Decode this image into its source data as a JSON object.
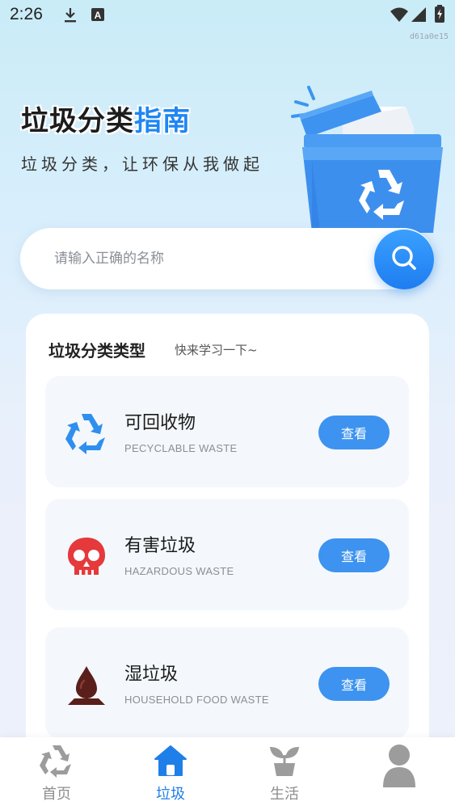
{
  "status_bar": {
    "time": "2:26",
    "build_id": "d61a0e15",
    "icons": [
      "download-icon",
      "notification-a-icon",
      "wifi-icon",
      "signal-icon",
      "battery-charging-icon"
    ]
  },
  "hero": {
    "title_part1": "垃圾分类",
    "title_part2": "指南",
    "subtitle": "垃圾分类，让环保从我做起",
    "illustration": "recycle-bin-icon"
  },
  "search": {
    "placeholder": "请输入正确的名称",
    "value": "",
    "button_icon": "search-icon"
  },
  "types_section": {
    "title": "垃圾分类类型",
    "subtitle": "快来学习一下~",
    "items": [
      {
        "name": "可回收物",
        "en": "PECYCLABLE WASTE",
        "button": "查看",
        "icon": "recycle-icon",
        "color": "#2f8fee"
      },
      {
        "name": "有害垃圾",
        "en": "HAZARDOUS WASTE",
        "button": "查看",
        "icon": "skull-icon",
        "color": "#e5393b"
      },
      {
        "name": "湿垃圾",
        "en": "HOUSEHOLD FOOD WASTE",
        "button": "查看",
        "icon": "water-drop-icon",
        "color": "#5a1f1a"
      }
    ]
  },
  "bottom_nav": {
    "active_index": 1,
    "items": [
      {
        "label": "首页",
        "icon": "recycle-icon"
      },
      {
        "label": "垃圾",
        "icon": "home-icon"
      },
      {
        "label": "生活",
        "icon": "plant-pot-icon"
      },
      {
        "label": "",
        "icon": "user-icon"
      }
    ]
  },
  "colors": {
    "accent": "#1f86f3",
    "button": "#3d93ef",
    "nav_active": "#1f7fe8",
    "nav_inactive": "#8e8e8e"
  }
}
